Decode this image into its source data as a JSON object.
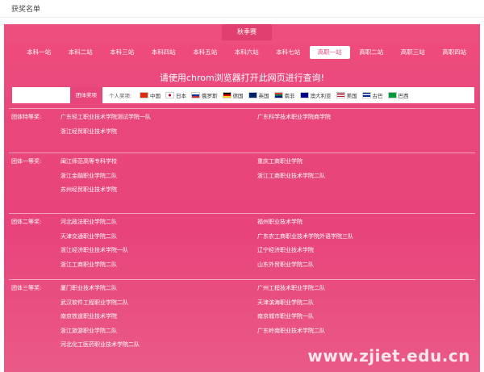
{
  "header": {
    "title": "获奖名单"
  },
  "season_tab": "秋季赛",
  "nav": {
    "items": [
      "本科一站",
      "本科二站",
      "本科三站",
      "本科四站",
      "本科五站",
      "本科六站",
      "本科七站",
      "高职一站",
      "高职二站",
      "高职三站",
      "高职四站"
    ],
    "active_index": 7
  },
  "notice": "请使用chrom浏览器打开此网页进行查询!",
  "filter": {
    "team_label": "团体奖项",
    "person_label": "个人奖项:",
    "countries": [
      {
        "name": "中国",
        "flag": "china-flag-icon"
      },
      {
        "name": "日本",
        "flag": "japan-flag-icon"
      },
      {
        "name": "俄罗斯",
        "flag": "russia-flag-icon"
      },
      {
        "name": "德国",
        "flag": "germany-flag-icon"
      },
      {
        "name": "英国",
        "flag": "uk-flag-icon"
      },
      {
        "name": "南非",
        "flag": "south-africa-flag-icon"
      },
      {
        "name": "澳大利亚",
        "flag": "australia-flag-icon"
      },
      {
        "name": "美国",
        "flag": "usa-flag-icon"
      },
      {
        "name": "古巴",
        "flag": "cuba-flag-icon"
      },
      {
        "name": "巴西",
        "flag": "brazil-flag-icon"
      }
    ]
  },
  "sections": [
    {
      "title": "团体特等奖:",
      "left": [
        "广东轻工职业技术学院测试学院一队",
        "浙江经贸职业技术学院"
      ],
      "right": [
        "广东科学技术职业学院商学院"
      ]
    },
    {
      "title": "团体一等奖:",
      "left": [
        "闽江师范高等专科学校",
        "浙江金融职业学院二队",
        "苏州经贸职业技术学院"
      ],
      "right": [
        "重庆工商职业学院",
        "浙江工商职业技术学院二队"
      ]
    },
    {
      "title": "团体二等奖:",
      "left": [
        "河北政法职业学院二队",
        "天津交通职业学院二队",
        "浙江经济职业技术学院一队",
        "浙江工商职业学院二队"
      ],
      "right": [
        "福州职业技术学院",
        "广东农工商职业技术学院外语学院三队",
        "辽宁经济职业技术学院",
        "山东外贸职业学院二队"
      ]
    },
    {
      "title": "团体三等奖:",
      "left": [
        "厦门职业技术学院二队",
        "武汉软件工程职业学院二队",
        "南京铁道职业技术学院",
        "浙江旅游职业学院二队",
        "河北化工医药职业技术学院二队"
      ],
      "right": [
        "广州工程技术职业学院二队",
        "天津滨海职业学院二队",
        "南京城市职业学院一队",
        "广东岭南职业技术学院二队"
      ]
    }
  ],
  "watermark": "www.zjiet.edu.cn"
}
